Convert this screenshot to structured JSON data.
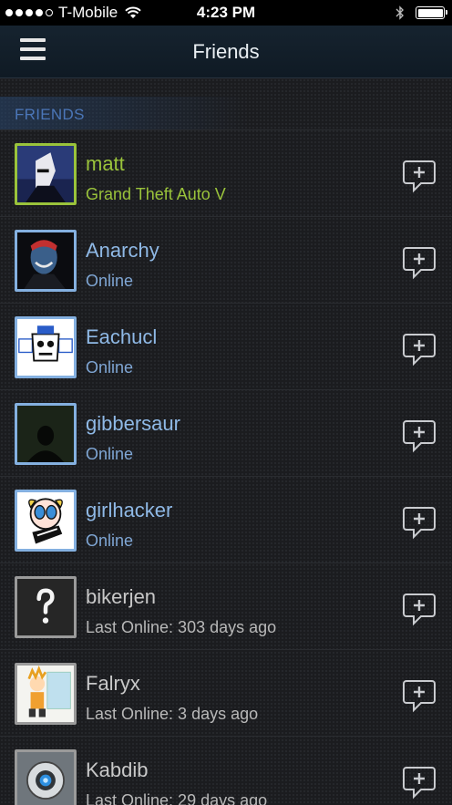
{
  "status_bar": {
    "carrier": "T-Mobile",
    "time": "4:23 PM",
    "signal_dots_filled": 4,
    "signal_dots_total": 5,
    "battery_level": 1.0
  },
  "header": {
    "title": "Friends",
    "menu_icon": "hamburger-menu-icon"
  },
  "section": {
    "label": "FRIENDS"
  },
  "friends": [
    {
      "name": "matt",
      "status": "Grand Theft Auto V",
      "state": "ingame"
    },
    {
      "name": "Anarchy",
      "status": "Online",
      "state": "online"
    },
    {
      "name": "Eachucl",
      "status": "Online",
      "state": "online"
    },
    {
      "name": "gibbersaur",
      "status": "Online",
      "state": "online"
    },
    {
      "name": "girlhacker",
      "status": "Online",
      "state": "online"
    },
    {
      "name": "bikerjen",
      "status": "Last Online: 303 days ago",
      "state": "offline"
    },
    {
      "name": "Falryx",
      "status": "Last Online: 3 days ago",
      "state": "offline"
    },
    {
      "name": "Kabdib",
      "status": "Last Online: 29 days ago",
      "state": "offline"
    }
  ],
  "colors": {
    "ingame": "#9ac33b",
    "online": "#8fb9e6",
    "offline": "#c8c8c8",
    "section_label": "#4b76b8"
  },
  "icons": {
    "chat": "chat-add-icon"
  }
}
